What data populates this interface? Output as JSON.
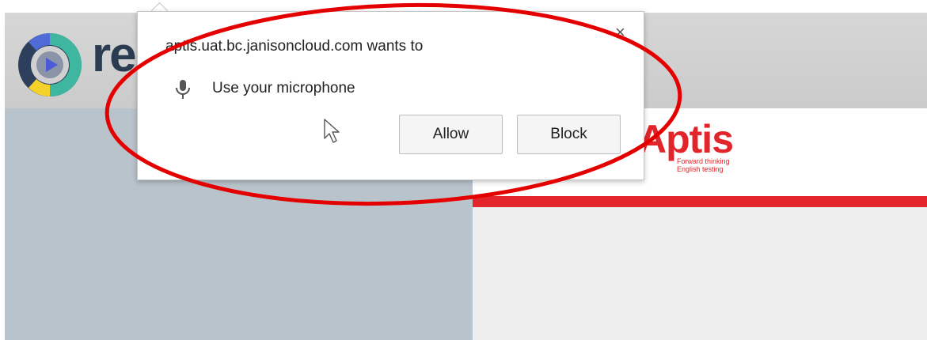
{
  "app": {
    "logo_text": "rep"
  },
  "aptis": {
    "logo": "Aptis",
    "tagline_1": "Forward thinking",
    "tagline_2": "English testing"
  },
  "dialog": {
    "title": "aptis.uat.bc.janisoncloud.com wants to",
    "permission_label": "Use your microphone",
    "allow_label": "Allow",
    "block_label": "Block",
    "close_glyph": "×",
    "permission_icon": "microphone-icon"
  },
  "colors": {
    "annotation": "#e50000",
    "aptis_red": "#e1252b",
    "logo_teal": "#3fb6a0"
  }
}
